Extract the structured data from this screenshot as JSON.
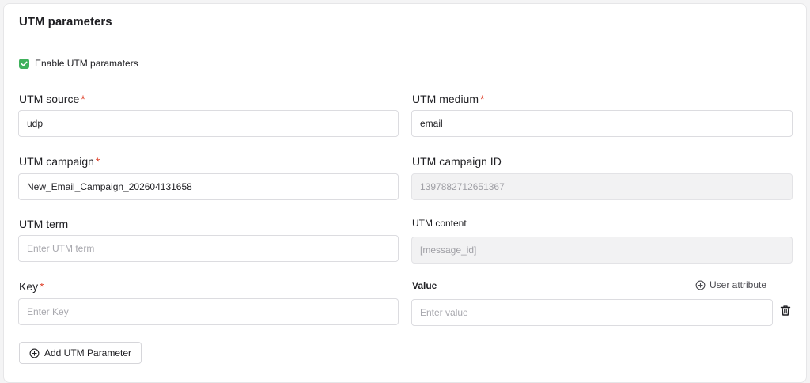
{
  "section": {
    "title": "UTM parameters"
  },
  "enable": {
    "label": "Enable UTM paramaters",
    "checked": true
  },
  "fields": {
    "utm_source": {
      "label": "UTM source",
      "required_mark": "*",
      "value": "udp"
    },
    "utm_medium": {
      "label": "UTM medium",
      "required_mark": "*",
      "value": "email"
    },
    "utm_campaign": {
      "label": "UTM campaign",
      "required_mark": "*",
      "value": "New_Email_Campaign_202604131658"
    },
    "utm_campaign_id": {
      "label": "UTM campaign ID",
      "value": "1397882712651367"
    },
    "utm_term": {
      "label": "UTM term",
      "placeholder": "Enter UTM term"
    },
    "utm_content": {
      "label": "UTM content",
      "value": "[message_id]"
    },
    "key": {
      "label": "Key",
      "required_mark": "*",
      "placeholder": "Enter Key"
    },
    "value": {
      "label": "Value",
      "placeholder": "Enter value"
    }
  },
  "actions": {
    "user_attribute": "User attribute",
    "add_parameter": "Add UTM Parameter"
  },
  "icons": {
    "check": "check-icon",
    "plus_circle": "plus-circle-icon",
    "trash": "trash-icon"
  },
  "colors": {
    "accent_green": "#3fb15c",
    "required_red": "#e0452f"
  }
}
